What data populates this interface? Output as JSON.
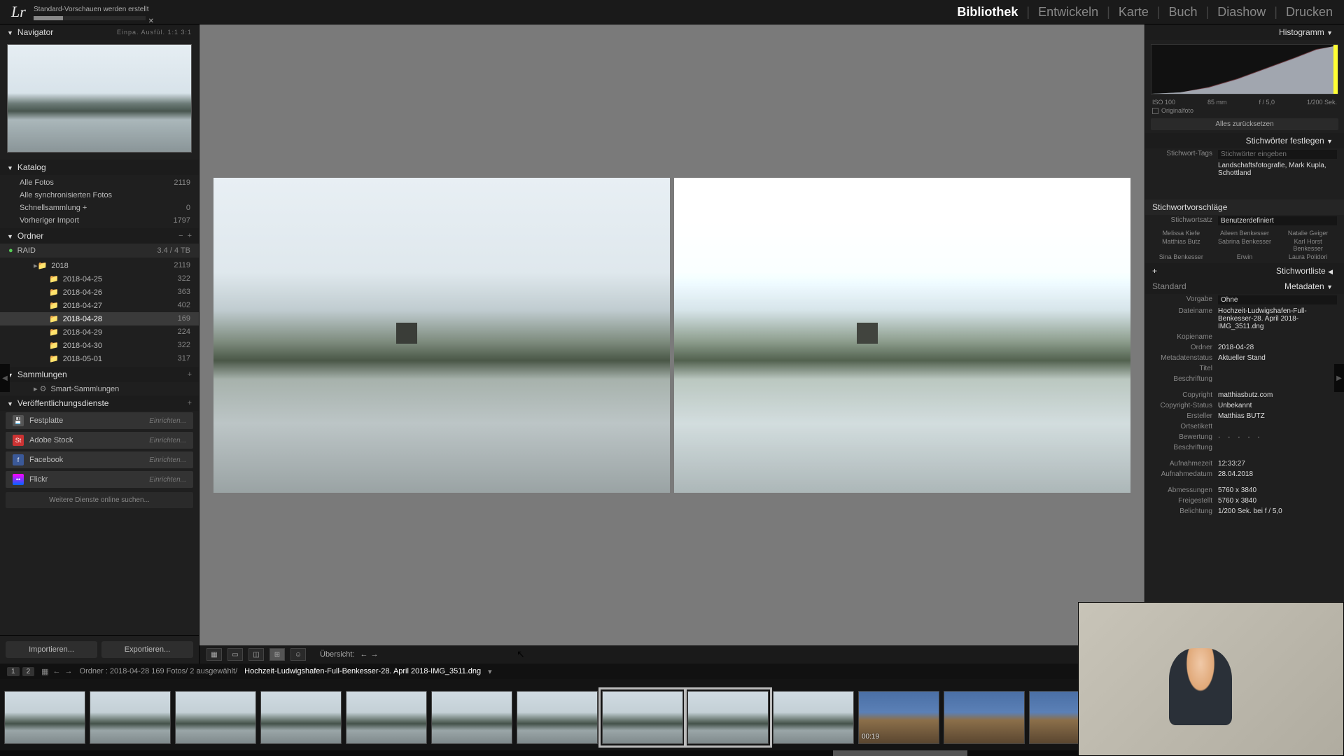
{
  "logo": "Lr",
  "status": {
    "text": "Standard-Vorschauen werden erstellt"
  },
  "modules": {
    "bibliothek": "Bibliothek",
    "entwickeln": "Entwickeln",
    "karte": "Karte",
    "buch": "Buch",
    "diashow": "Diashow",
    "drucken": "Drucken"
  },
  "left": {
    "navigator": {
      "title": "Navigator",
      "opts": "Einpa.  Ausfül.  1:1  3:1"
    },
    "katalog": {
      "title": "Katalog",
      "items": [
        {
          "label": "Alle Fotos",
          "count": "2119"
        },
        {
          "label": "Alle synchronisierten Fotos",
          "count": ""
        },
        {
          "label": "Schnellsammlung  +",
          "count": "0"
        },
        {
          "label": "Vorheriger Import",
          "count": "1797"
        }
      ]
    },
    "ordner": {
      "title": "Ordner",
      "volume": {
        "name": "RAID",
        "size": "3.4 / 4 TB"
      },
      "year": {
        "label": "2018",
        "count": "2119"
      },
      "dates": [
        {
          "label": "2018-04-25",
          "count": "322"
        },
        {
          "label": "2018-04-26",
          "count": "363"
        },
        {
          "label": "2018-04-27",
          "count": "402"
        },
        {
          "label": "2018-04-28",
          "count": "169",
          "sel": true
        },
        {
          "label": "2018-04-29",
          "count": "224"
        },
        {
          "label": "2018-04-30",
          "count": "322"
        },
        {
          "label": "2018-05-01",
          "count": "317"
        }
      ]
    },
    "sammlungen": {
      "title": "Sammlungen",
      "smart": "Smart-Sammlungen"
    },
    "publish": {
      "title": "Veröffentlichungsdienste",
      "services": [
        {
          "label": "Festplatte",
          "setup": "Einrichten..."
        },
        {
          "label": "Adobe Stock",
          "setup": "Einrichten..."
        },
        {
          "label": "Facebook",
          "setup": "Einrichten..."
        },
        {
          "label": "Flickr",
          "setup": "Einrichten..."
        }
      ],
      "more": "Weitere Dienste online suchen..."
    },
    "actions": {
      "import": "Importieren...",
      "export": "Exportieren..."
    }
  },
  "toolbar": {
    "label": "Übersicht:"
  },
  "statusline": {
    "chip1": "1",
    "chip2": "2",
    "path": "Ordner : 2018-04-28   169 Fotos/ 2 ausgewählt/",
    "file": "Hochzeit-Ludwigshafen-Full-Benkesser-28. April 2018-IMG_3511.dng"
  },
  "filmstrip": {
    "video_dur": "00:19"
  },
  "right": {
    "histogram": {
      "title": "Histogramm",
      "iso": "ISO 100",
      "focal": "85 mm",
      "aperture": "f / 5,0",
      "shutter": "1/200 Sek.",
      "orig": "Originalfoto"
    },
    "reset": "Alles zurücksetzen",
    "keywords": {
      "title": "Stichwörter festlegen",
      "tags_label": "Stichwort-Tags",
      "tags_hint": "Stichwörter eingeben",
      "tags_value": "Landschaftsfotografie, Mark Kupla, Schottland",
      "suggest_title": "Stichwortvorschläge",
      "set_label": "Stichwortsatz",
      "set_value": "Benutzerdefiniert",
      "suggestions": [
        "Melissa Kiefe",
        "Aileen Benkesser",
        "Natalie Geiger",
        "Matthias Butz",
        "Sabrina Benkesser",
        "Karl Horst Benkesser",
        "Sina Benkesser",
        "Erwin",
        "Laura Polidori"
      ]
    },
    "keywordlist": {
      "title": "Stichwortliste"
    },
    "metadata": {
      "title": "Metadaten",
      "standard": "Standard",
      "fields": {
        "vorgabe_k": "Vorgabe",
        "vorgabe_v": "Ohne",
        "dateiname_k": "Dateiname",
        "dateiname_v": "Hochzeit-Ludwigshafen-Full-Benkesser-28. April 2018-IMG_3511.dng",
        "kopiename_k": "Kopiename",
        "kopiename_v": "",
        "ordner_k": "Ordner",
        "ordner_v": "2018-04-28",
        "metastatus_k": "Metadatenstatus",
        "metastatus_v": "Aktueller Stand",
        "titel_k": "Titel",
        "titel_v": "",
        "beschriftung_k": "Beschriftung",
        "beschriftung_v": "",
        "copyright_k": "Copyright",
        "copyright_v": "matthiasbutz.com",
        "copystatus_k": "Copyright-Status",
        "copystatus_v": "Unbekannt",
        "ersteller_k": "Ersteller",
        "ersteller_v": "Matthias BUTZ",
        "ortsetikett_k": "Ortsetikett",
        "ortsetikett_v": "",
        "bewertung_k": "Bewertung",
        "beschriftung2_k": "Beschriftung",
        "beschriftung2_v": "",
        "aufnahmezeit_k": "Aufnahmezeit",
        "aufnahmezeit_v": "12:33:27",
        "aufnahmedatum_k": "Aufnahmedatum",
        "aufnahmedatum_v": "28.04.2018",
        "abmessungen_k": "Abmessungen",
        "abmessungen_v": "5760 x 3840",
        "freigestellt_k": "Freigestellt",
        "freigestellt_v": "5760 x 3840",
        "belichtung_k": "Belichtung",
        "belichtung_v": "1/200 Sek. bei f / 5,0"
      }
    }
  }
}
